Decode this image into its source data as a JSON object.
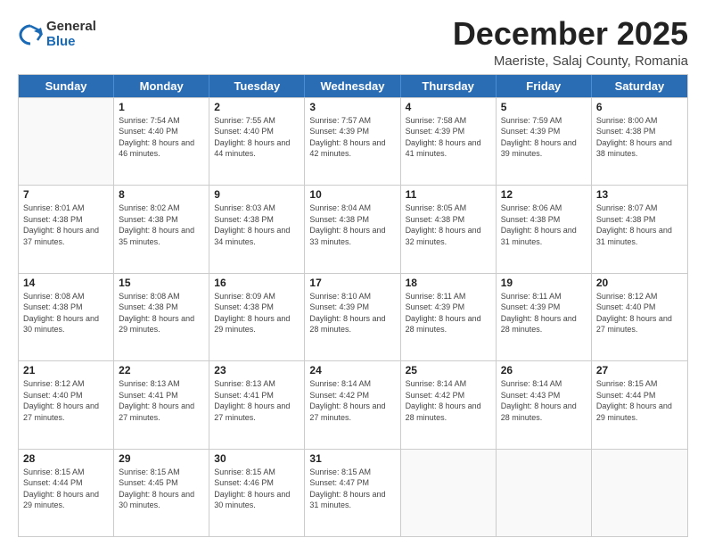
{
  "header": {
    "logo_general": "General",
    "logo_blue": "Blue",
    "month_title": "December 2025",
    "location": "Maeriste, Salaj County, Romania"
  },
  "weekdays": [
    "Sunday",
    "Monday",
    "Tuesday",
    "Wednesday",
    "Thursday",
    "Friday",
    "Saturday"
  ],
  "weeks": [
    [
      {
        "day": "",
        "empty": true
      },
      {
        "day": "1",
        "sunrise": "Sunrise: 7:54 AM",
        "sunset": "Sunset: 4:40 PM",
        "daylight": "Daylight: 8 hours and 46 minutes."
      },
      {
        "day": "2",
        "sunrise": "Sunrise: 7:55 AM",
        "sunset": "Sunset: 4:40 PM",
        "daylight": "Daylight: 8 hours and 44 minutes."
      },
      {
        "day": "3",
        "sunrise": "Sunrise: 7:57 AM",
        "sunset": "Sunset: 4:39 PM",
        "daylight": "Daylight: 8 hours and 42 minutes."
      },
      {
        "day": "4",
        "sunrise": "Sunrise: 7:58 AM",
        "sunset": "Sunset: 4:39 PM",
        "daylight": "Daylight: 8 hours and 41 minutes."
      },
      {
        "day": "5",
        "sunrise": "Sunrise: 7:59 AM",
        "sunset": "Sunset: 4:39 PM",
        "daylight": "Daylight: 8 hours and 39 minutes."
      },
      {
        "day": "6",
        "sunrise": "Sunrise: 8:00 AM",
        "sunset": "Sunset: 4:38 PM",
        "daylight": "Daylight: 8 hours and 38 minutes."
      }
    ],
    [
      {
        "day": "7",
        "sunrise": "Sunrise: 8:01 AM",
        "sunset": "Sunset: 4:38 PM",
        "daylight": "Daylight: 8 hours and 37 minutes."
      },
      {
        "day": "8",
        "sunrise": "Sunrise: 8:02 AM",
        "sunset": "Sunset: 4:38 PM",
        "daylight": "Daylight: 8 hours and 35 minutes."
      },
      {
        "day": "9",
        "sunrise": "Sunrise: 8:03 AM",
        "sunset": "Sunset: 4:38 PM",
        "daylight": "Daylight: 8 hours and 34 minutes."
      },
      {
        "day": "10",
        "sunrise": "Sunrise: 8:04 AM",
        "sunset": "Sunset: 4:38 PM",
        "daylight": "Daylight: 8 hours and 33 minutes."
      },
      {
        "day": "11",
        "sunrise": "Sunrise: 8:05 AM",
        "sunset": "Sunset: 4:38 PM",
        "daylight": "Daylight: 8 hours and 32 minutes."
      },
      {
        "day": "12",
        "sunrise": "Sunrise: 8:06 AM",
        "sunset": "Sunset: 4:38 PM",
        "daylight": "Daylight: 8 hours and 31 minutes."
      },
      {
        "day": "13",
        "sunrise": "Sunrise: 8:07 AM",
        "sunset": "Sunset: 4:38 PM",
        "daylight": "Daylight: 8 hours and 31 minutes."
      }
    ],
    [
      {
        "day": "14",
        "sunrise": "Sunrise: 8:08 AM",
        "sunset": "Sunset: 4:38 PM",
        "daylight": "Daylight: 8 hours and 30 minutes."
      },
      {
        "day": "15",
        "sunrise": "Sunrise: 8:08 AM",
        "sunset": "Sunset: 4:38 PM",
        "daylight": "Daylight: 8 hours and 29 minutes."
      },
      {
        "day": "16",
        "sunrise": "Sunrise: 8:09 AM",
        "sunset": "Sunset: 4:38 PM",
        "daylight": "Daylight: 8 hours and 29 minutes."
      },
      {
        "day": "17",
        "sunrise": "Sunrise: 8:10 AM",
        "sunset": "Sunset: 4:39 PM",
        "daylight": "Daylight: 8 hours and 28 minutes."
      },
      {
        "day": "18",
        "sunrise": "Sunrise: 8:11 AM",
        "sunset": "Sunset: 4:39 PM",
        "daylight": "Daylight: 8 hours and 28 minutes."
      },
      {
        "day": "19",
        "sunrise": "Sunrise: 8:11 AM",
        "sunset": "Sunset: 4:39 PM",
        "daylight": "Daylight: 8 hours and 28 minutes."
      },
      {
        "day": "20",
        "sunrise": "Sunrise: 8:12 AM",
        "sunset": "Sunset: 4:40 PM",
        "daylight": "Daylight: 8 hours and 27 minutes."
      }
    ],
    [
      {
        "day": "21",
        "sunrise": "Sunrise: 8:12 AM",
        "sunset": "Sunset: 4:40 PM",
        "daylight": "Daylight: 8 hours and 27 minutes."
      },
      {
        "day": "22",
        "sunrise": "Sunrise: 8:13 AM",
        "sunset": "Sunset: 4:41 PM",
        "daylight": "Daylight: 8 hours and 27 minutes."
      },
      {
        "day": "23",
        "sunrise": "Sunrise: 8:13 AM",
        "sunset": "Sunset: 4:41 PM",
        "daylight": "Daylight: 8 hours and 27 minutes."
      },
      {
        "day": "24",
        "sunrise": "Sunrise: 8:14 AM",
        "sunset": "Sunset: 4:42 PM",
        "daylight": "Daylight: 8 hours and 27 minutes."
      },
      {
        "day": "25",
        "sunrise": "Sunrise: 8:14 AM",
        "sunset": "Sunset: 4:42 PM",
        "daylight": "Daylight: 8 hours and 28 minutes."
      },
      {
        "day": "26",
        "sunrise": "Sunrise: 8:14 AM",
        "sunset": "Sunset: 4:43 PM",
        "daylight": "Daylight: 8 hours and 28 minutes."
      },
      {
        "day": "27",
        "sunrise": "Sunrise: 8:15 AM",
        "sunset": "Sunset: 4:44 PM",
        "daylight": "Daylight: 8 hours and 29 minutes."
      }
    ],
    [
      {
        "day": "28",
        "sunrise": "Sunrise: 8:15 AM",
        "sunset": "Sunset: 4:44 PM",
        "daylight": "Daylight: 8 hours and 29 minutes."
      },
      {
        "day": "29",
        "sunrise": "Sunrise: 8:15 AM",
        "sunset": "Sunset: 4:45 PM",
        "daylight": "Daylight: 8 hours and 30 minutes."
      },
      {
        "day": "30",
        "sunrise": "Sunrise: 8:15 AM",
        "sunset": "Sunset: 4:46 PM",
        "daylight": "Daylight: 8 hours and 30 minutes."
      },
      {
        "day": "31",
        "sunrise": "Sunrise: 8:15 AM",
        "sunset": "Sunset: 4:47 PM",
        "daylight": "Daylight: 8 hours and 31 minutes."
      },
      {
        "day": "",
        "empty": true
      },
      {
        "day": "",
        "empty": true
      },
      {
        "day": "",
        "empty": true
      }
    ]
  ]
}
